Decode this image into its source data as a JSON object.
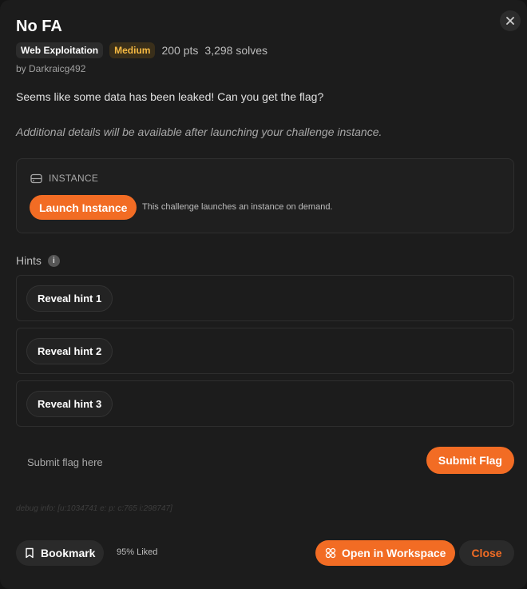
{
  "modal": {
    "close_icon": "close-icon",
    "title": "No FA",
    "category": "Web Exploitation",
    "difficulty": "Medium",
    "points": "200 pts",
    "solves": "3,298 solves",
    "author": "by Darkraicg492",
    "description": "Seems like some data has been leaked! Can you get the flag?",
    "note": "Additional details will be available after launching your challenge instance."
  },
  "instance": {
    "icon": "server-icon",
    "heading": "INSTANCE",
    "launch_label": "Launch Instance",
    "launch_note": "This challenge launches an instance on demand."
  },
  "hints": {
    "label": "Hints",
    "info_icon": "info-icon",
    "info_glyph": "i",
    "items": [
      {
        "label": "Reveal hint 1"
      },
      {
        "label": "Reveal hint 2"
      },
      {
        "label": "Reveal hint 3"
      }
    ]
  },
  "flag": {
    "placeholder": "Submit flag here",
    "value": "",
    "submit_label": "Submit Flag"
  },
  "debug_info": "debug info: [u:1034741 e: p: c:765 i:298747]",
  "footer": {
    "bookmark_label": "Bookmark",
    "bookmark_icon": "bookmark-icon",
    "liked": "95% Liked",
    "workspace_label": "Open in Workspace",
    "workspace_icon": "workspace-icon",
    "close_label": "Close"
  },
  "colors": {
    "accent": "#f26c24",
    "difficulty": "#f5b942",
    "background": "#1c1c1c"
  }
}
